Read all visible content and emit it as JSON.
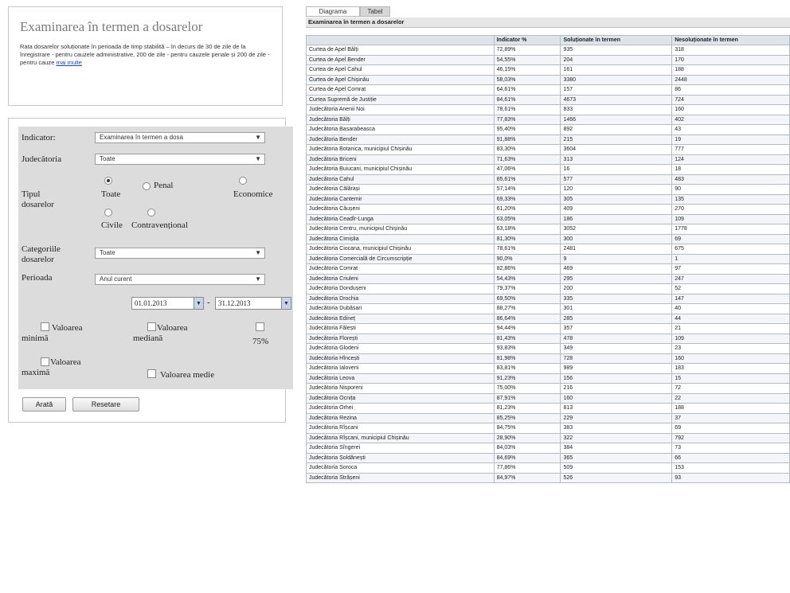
{
  "info": {
    "title": "Examinarea în termen a dosarelor",
    "text": "Rata dosarelor soluționate în perioada de timp stabilită – în decurs de 30 de zile de la înregistrare - pentru cauzele administrative, 200 de zile - pentru cauzele penale și 200 de zile - pentru cauze",
    "link": "mai multe"
  },
  "form": {
    "indicator_label": "Indicator:",
    "indicator_value": "Examinarea în termen a dosa",
    "court_label": "Judecătoria",
    "court_value": "Toate",
    "type_label": "Tipul dosarelor",
    "radios": [
      "Toate",
      "Penal",
      "Economice",
      "Civile",
      "Contravențional"
    ],
    "category_label": "Categoriile dosarelor",
    "category_value": "Toate",
    "period_label": "Perioada",
    "period_value": "Anul curent",
    "date_from": "01.01.2013",
    "date_sep": "-",
    "date_to": "31.12.2013",
    "checks": {
      "min": "Valoarea minimă",
      "median": "Valoarea mediană",
      "p75": "75%",
      "max": "Valoarea maximă",
      "mean": "Valoarea medie"
    },
    "show_button": "Arată",
    "reset_button": "Resetare"
  },
  "tabs": [
    "Diagrama",
    "Tabel"
  ],
  "table": {
    "title": "Examinarea în termen a dosarelor",
    "headers": [
      "",
      "Indicator %",
      "Soluționate în termen",
      "Nesoluționate în termen"
    ],
    "rows": [
      [
        "Curtea de Apel Bălți",
        "72,89%",
        "935",
        "318"
      ],
      [
        "Curtea de Apel Bender",
        "54,55%",
        "204",
        "170"
      ],
      [
        "Curtea de Apel Cahul",
        "46,15%",
        "161",
        "188"
      ],
      [
        "Curtea de Apel Chișinău",
        "58,03%",
        "3380",
        "2448"
      ],
      [
        "Curtea de Apel Comrat",
        "64,61%",
        "157",
        "86"
      ],
      [
        "Curtea Supremă de Justiție",
        "84,61%",
        "4673",
        "724"
      ],
      [
        "Judecătoria Anenii Noi",
        "78,61%",
        "833",
        "160"
      ],
      [
        "Judecătoria Bălți",
        "77,83%",
        "1466",
        "402"
      ],
      [
        "Judecătoria Basarabeasca",
        "95,40%",
        "892",
        "43"
      ],
      [
        "Judecătoria Bender",
        "91,88%",
        "215",
        "19"
      ],
      [
        "Judecătoria Botanica, municipiul Chișinău",
        "83,30%",
        "3604",
        "777"
      ],
      [
        "Judecătoria Briceni",
        "71,63%",
        "313",
        "124"
      ],
      [
        "Judecătoria Buiucani, municipiul Chișinău",
        "47,06%",
        "16",
        "18"
      ],
      [
        "Judecătoria Cahul",
        "85,61%",
        "577",
        "483"
      ],
      [
        "Judecătoria Călărași",
        "57,14%",
        "120",
        "90"
      ],
      [
        "Judecătoria Cantemir",
        "69,33%",
        "305",
        "135"
      ],
      [
        "Judecătoria Căușeni",
        "61,20%",
        "409",
        "270"
      ],
      [
        "Judecătoria Ceadîr-Lunga",
        "63,05%",
        "186",
        "109"
      ],
      [
        "Judecătoria Centru, municipiul Chișinău",
        "63,18%",
        "3052",
        "1778"
      ],
      [
        "Judecătoria Cimișlia",
        "81,30%",
        "300",
        "69"
      ],
      [
        "Judecătoria Ciocana, municipiul Chișinău",
        "78,61%",
        "2481",
        "675"
      ],
      [
        "Judecătoria Comercială de Circumscripție",
        "90,0%",
        "9",
        "1"
      ],
      [
        "Judecătoria Comrat",
        "82,86%",
        "469",
        "97"
      ],
      [
        "Judecătoria Criuleni",
        "54,43%",
        "295",
        "247"
      ],
      [
        "Judecătoria Dondușeni",
        "79,37%",
        "200",
        "52"
      ],
      [
        "Judecătoria Drochia",
        "69,50%",
        "335",
        "147"
      ],
      [
        "Judecătoria Dubăsari",
        "88,27%",
        "301",
        "40"
      ],
      [
        "Judecătoria Edineț",
        "86,64%",
        "285",
        "44"
      ],
      [
        "Judecătoria Fălești",
        "94,44%",
        "357",
        "21"
      ],
      [
        "Judecătoria Florești",
        "81,43%",
        "478",
        "109"
      ],
      [
        "Judecătoria Glodeni",
        "93,83%",
        "349",
        "23"
      ],
      [
        "Judecătoria Hîncești",
        "81,98%",
        "728",
        "160"
      ],
      [
        "Judecătoria Ialoveni",
        "83,81%",
        "989",
        "183"
      ],
      [
        "Judecătoria Leova",
        "91,23%",
        "156",
        "15"
      ],
      [
        "Judecătoria Nisporeni",
        "75,00%",
        "216",
        "72"
      ],
      [
        "Judecătoria Ocnița",
        "87,91%",
        "160",
        "22"
      ],
      [
        "Judecătoria Orhei",
        "81,23%",
        "813",
        "188"
      ],
      [
        "Judecătoria Rezina",
        "85,25%",
        "229",
        "37"
      ],
      [
        "Judecătoria Rîșcani",
        "84,75%",
        "383",
        "69"
      ],
      [
        "Judecătoria Rîșcani, municipiul Chișinău",
        "28,90%",
        "322",
        "792"
      ],
      [
        "Judecătoria Sîngerei",
        "84,03%",
        "384",
        "73"
      ],
      [
        "Judecătoria Șoldănești",
        "84,69%",
        "365",
        "66"
      ],
      [
        "Judecătoria Soroca",
        "77,86%",
        "509",
        "153"
      ],
      [
        "Judecătoria Strășeni",
        "84,97%",
        "526",
        "93"
      ]
    ]
  }
}
